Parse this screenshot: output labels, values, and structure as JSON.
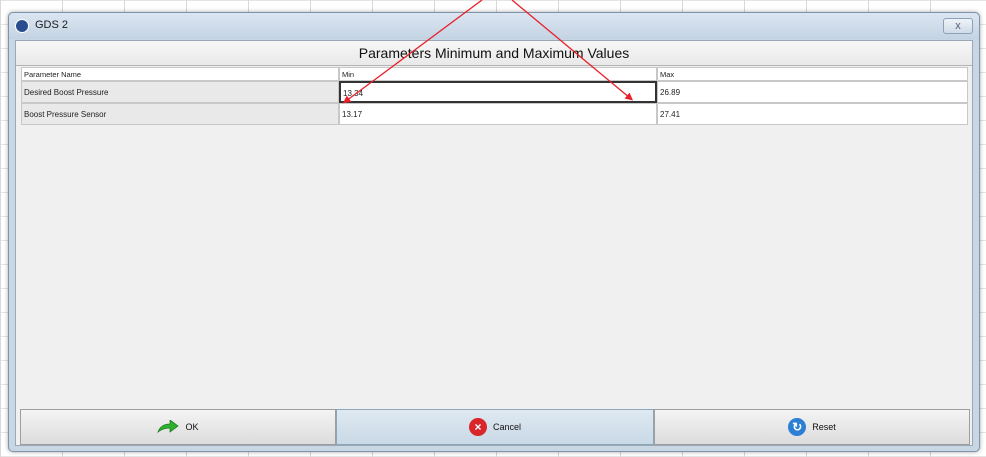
{
  "window": {
    "title": "GDS 2",
    "close_glyph": "x"
  },
  "dialog": {
    "heading": "Parameters Minimum and Maximum Values"
  },
  "table": {
    "headers": [
      "Parameter Name",
      "Min",
      "Max"
    ],
    "rows": [
      {
        "name": "Desired Boost Pressure",
        "min": "13.34",
        "max": "26.89"
      },
      {
        "name": "Boost Pressure Sensor",
        "min": "13.17",
        "max": "27.41"
      }
    ]
  },
  "buttons": {
    "ok": "OK",
    "cancel": "Cancel",
    "reset": "Reset"
  },
  "icons": {
    "ok": "green-arrow-icon",
    "cancel": "red-x-circle-icon",
    "reset": "blue-refresh-icon",
    "window": "gds-logo-icon"
  },
  "colors": {
    "annotation_arrows": "#e8202a",
    "ok_icon": "#2fb12f",
    "cancel_icon": "#d8262a",
    "reset_icon": "#2b7fd4"
  }
}
